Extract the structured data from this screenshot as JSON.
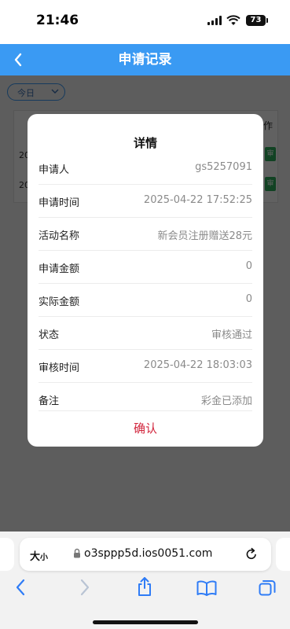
{
  "status_bar": {
    "time": "21:46",
    "battery": "73"
  },
  "nav": {
    "title": "申请记录"
  },
  "page": {
    "date_filter": "今日",
    "table_header_partial": "作",
    "row_dates_partial": [
      "20",
      "20"
    ],
    "row_action_partial": "审"
  },
  "modal": {
    "title": "详情",
    "rows": [
      {
        "label": "申请人",
        "value": "gs5257091"
      },
      {
        "label": "申请时间",
        "value": "2025-04-22 17:52:25"
      },
      {
        "label": "活动名称",
        "value": "新会员注册赠送28元"
      },
      {
        "label": "申请金额",
        "value": "0"
      },
      {
        "label": "实际金额",
        "value": "0"
      },
      {
        "label": "状态",
        "value": "审核通过"
      },
      {
        "label": "审核时间",
        "value": "2025-04-22 18:03:03"
      },
      {
        "label": "备注",
        "value": "彩金已添加"
      }
    ],
    "confirm_label": "确认"
  },
  "browser": {
    "text_size_label": "大",
    "text_size_small": "小",
    "url": "o3sppp5d.ios0051.com"
  },
  "icons": {
    "back": "chevron-left-icon",
    "forward": "chevron-right-icon",
    "share": "share-icon",
    "bookmarks": "book-icon",
    "tabs": "tabs-icon",
    "lock": "lock-icon",
    "reload": "reload-icon"
  },
  "colors": {
    "nav_bg": "#3a9af3",
    "confirm_text": "#d2263d",
    "action_green": "#2fae5e",
    "browser_blue": "#2f7cf6"
  }
}
